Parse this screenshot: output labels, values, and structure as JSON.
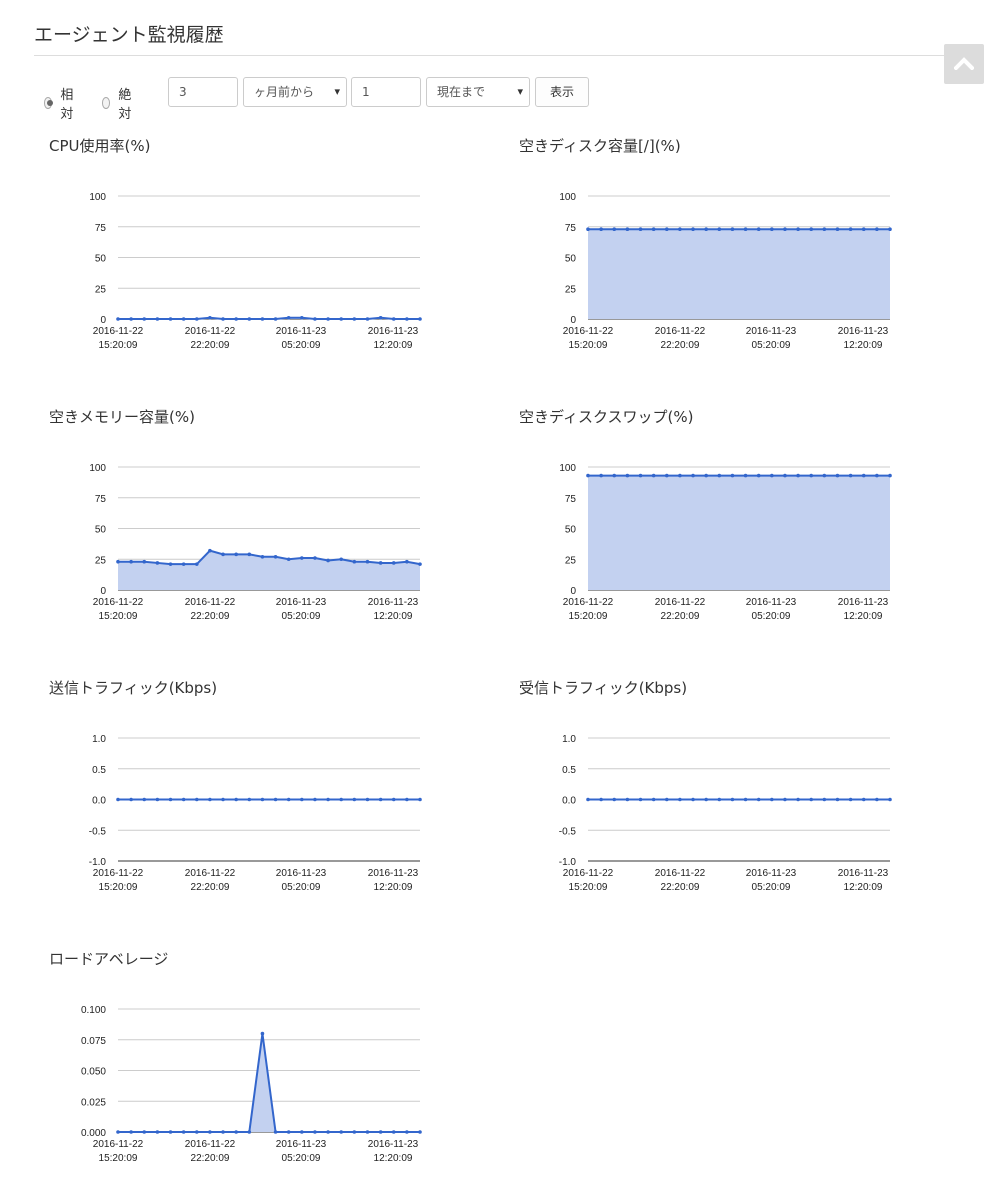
{
  "page": {
    "title": "エージェント監視履歴"
  },
  "controls": {
    "relative_label": "相対",
    "absolute_label": "絶対",
    "relative_selected": true,
    "from_value": "3",
    "from_unit": "ヶ月前から",
    "to_value": "1",
    "to_unit": "現在まで",
    "show_button": "表示"
  },
  "colors": {
    "line": "#3366cc",
    "fill": "#c3d1f0",
    "grid": "#cccccc",
    "axis": "#333333"
  },
  "chart_data": [
    {
      "type": "area",
      "title": "CPU使用率(%)",
      "x_ticks": [
        "2016-11-22\n15:20:09",
        "2016-11-22\n22:20:09",
        "2016-11-23\n05:20:09",
        "2016-11-23\n12:20:09"
      ],
      "y_ticks": [
        "100",
        "75",
        "50",
        "25",
        "0"
      ],
      "ylim": [
        0,
        100
      ],
      "values": [
        0,
        0,
        0,
        0,
        0,
        0,
        0,
        1,
        0,
        0,
        0,
        0,
        0,
        1,
        1,
        0,
        0,
        0,
        0,
        0,
        1,
        0,
        0,
        0
      ]
    },
    {
      "type": "area",
      "title": "空きディスク容量[/](%)",
      "x_ticks": [
        "2016-11-22\n15:20:09",
        "2016-11-22\n22:20:09",
        "2016-11-23\n05:20:09",
        "2016-11-23\n12:20:09"
      ],
      "y_ticks": [
        "100",
        "75",
        "50",
        "25",
        "0"
      ],
      "ylim": [
        0,
        100
      ],
      "values": [
        73,
        73,
        73,
        73,
        73,
        73,
        73,
        73,
        73,
        73,
        73,
        73,
        73,
        73,
        73,
        73,
        73,
        73,
        73,
        73,
        73,
        73,
        73,
        73
      ]
    },
    {
      "type": "area",
      "title": "空きメモリー容量(%)",
      "x_ticks": [
        "2016-11-22\n15:20:09",
        "2016-11-22\n22:20:09",
        "2016-11-23\n05:20:09",
        "2016-11-23\n12:20:09"
      ],
      "y_ticks": [
        "100",
        "75",
        "50",
        "25",
        "0"
      ],
      "ylim": [
        0,
        100
      ],
      "values": [
        23,
        23,
        23,
        22,
        21,
        21,
        21,
        32,
        29,
        29,
        29,
        27,
        27,
        25,
        26,
        26,
        24,
        25,
        23,
        23,
        22,
        22,
        23,
        21
      ]
    },
    {
      "type": "area",
      "title": "空きディスクスワップ(%)",
      "x_ticks": [
        "2016-11-22\n15:20:09",
        "2016-11-22\n22:20:09",
        "2016-11-23\n05:20:09",
        "2016-11-23\n12:20:09"
      ],
      "y_ticks": [
        "100",
        "75",
        "50",
        "25",
        "0"
      ],
      "ylim": [
        0,
        100
      ],
      "values": [
        93,
        93,
        93,
        93,
        93,
        93,
        93,
        93,
        93,
        93,
        93,
        93,
        93,
        93,
        93,
        93,
        93,
        93,
        93,
        93,
        93,
        93,
        93,
        93
      ]
    },
    {
      "type": "area",
      "title": "送信トラフィック(Kbps)",
      "x_ticks": [
        "2016-11-22\n15:20:09",
        "2016-11-22\n22:20:09",
        "2016-11-23\n05:20:09",
        "2016-11-23\n12:20:09"
      ],
      "y_ticks": [
        "1.0",
        "0.5",
        "0.0",
        "-0.5",
        "-1.0"
      ],
      "ylim": [
        -1,
        1
      ],
      "values": [
        0,
        0,
        0,
        0,
        0,
        0,
        0,
        0,
        0,
        0,
        0,
        0,
        0,
        0,
        0,
        0,
        0,
        0,
        0,
        0,
        0,
        0,
        0,
        0
      ]
    },
    {
      "type": "area",
      "title": "受信トラフィック(Kbps)",
      "x_ticks": [
        "2016-11-22\n15:20:09",
        "2016-11-22\n22:20:09",
        "2016-11-23\n05:20:09",
        "2016-11-23\n12:20:09"
      ],
      "y_ticks": [
        "1.0",
        "0.5",
        "0.0",
        "-0.5",
        "-1.0"
      ],
      "ylim": [
        -1,
        1
      ],
      "values": [
        0,
        0,
        0,
        0,
        0,
        0,
        0,
        0,
        0,
        0,
        0,
        0,
        0,
        0,
        0,
        0,
        0,
        0,
        0,
        0,
        0,
        0,
        0,
        0
      ]
    },
    {
      "type": "area",
      "title": "ロードアベレージ",
      "x_ticks": [
        "2016-11-22\n15:20:09",
        "2016-11-22\n22:20:09",
        "2016-11-23\n05:20:09",
        "2016-11-23\n12:20:09"
      ],
      "y_ticks": [
        "0.100",
        "0.075",
        "0.050",
        "0.025",
        "0.000"
      ],
      "ylim": [
        0,
        0.1
      ],
      "values": [
        0,
        0,
        0,
        0,
        0,
        0,
        0,
        0,
        0,
        0,
        0,
        0.08,
        0,
        0,
        0,
        0,
        0,
        0,
        0,
        0,
        0,
        0,
        0,
        0
      ]
    }
  ]
}
